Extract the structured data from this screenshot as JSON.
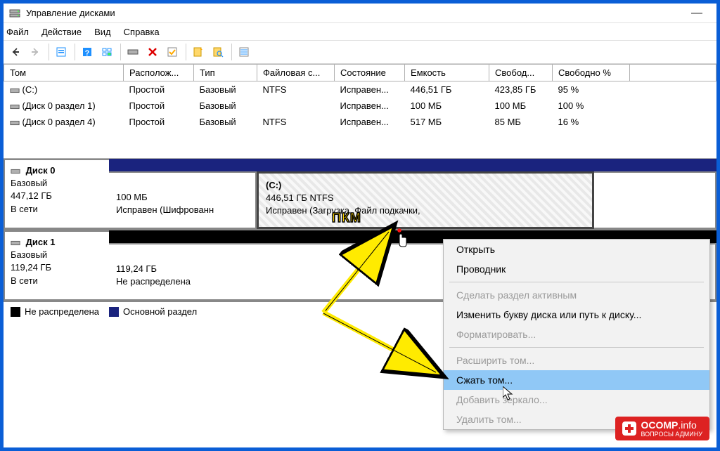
{
  "window": {
    "title": "Управление дисками",
    "minimize": "—"
  },
  "menu": {
    "file": "Файл",
    "action": "Действие",
    "view": "Вид",
    "help": "Справка"
  },
  "columns": {
    "vol": "Том",
    "layout": "Располож...",
    "type": "Тип",
    "fs": "Файловая с...",
    "status": "Состояние",
    "capacity": "Емкость",
    "free": "Свобод...",
    "freepct": "Свободно %"
  },
  "rows": [
    {
      "name": "(C:)",
      "layout": "Простой",
      "type": "Базовый",
      "fs": "NTFS",
      "status": "Исправен...",
      "cap": "446,51 ГБ",
      "free": "423,85 ГБ",
      "pct": "95 %"
    },
    {
      "name": "(Диск 0 раздел 1)",
      "layout": "Простой",
      "type": "Базовый",
      "fs": "",
      "status": "Исправен...",
      "cap": "100 МБ",
      "free": "100 МБ",
      "pct": "100 %"
    },
    {
      "name": "(Диск 0 раздел 4)",
      "layout": "Простой",
      "type": "Базовый",
      "fs": "NTFS",
      "status": "Исправен...",
      "cap": "517 МБ",
      "free": "85 МБ",
      "pct": "16 %"
    }
  ],
  "disk0": {
    "name": "Диск 0",
    "type": "Базовый",
    "size": "447,12 ГБ",
    "status": "В сети",
    "seg1_size": "100 МБ",
    "seg1_status": "Исправен (Шифрованн",
    "seg2_title": "(C:)",
    "seg2_size": "446,51 ГБ NTFS",
    "seg2_status": "Исправен (Загрузка, Файл подкачки,"
  },
  "disk1": {
    "name": "Диск 1",
    "type": "Базовый",
    "size": "119,24 ГБ",
    "status": "В сети",
    "seg1_size": "119,24 ГБ",
    "seg1_status": "Не распределена"
  },
  "legend": {
    "unalloc": "Не распределена",
    "primary": "Основной раздел"
  },
  "context": {
    "open": "Открыть",
    "explorer": "Проводник",
    "active": "Сделать раздел активным",
    "letter": "Изменить букву диска или путь к диску...",
    "format": "Форматировать...",
    "extend": "Расширить том...",
    "shrink": "Сжать том...",
    "mirror": "Добавить зеркало...",
    "delete": "Удалить том..."
  },
  "annot": {
    "pkm": "ПКМ"
  },
  "watermark": {
    "brand": "OCOMP",
    "domain": ".info",
    "sub": "ВОПРОСЫ АДМИНУ"
  }
}
